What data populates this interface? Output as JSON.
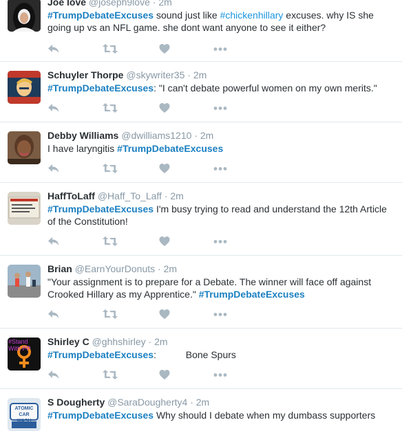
{
  "tweets": [
    {
      "name": "Joe love",
      "handle": "@joseph9love",
      "time": "2m",
      "segments": [
        {
          "t": "#TrumpDebateExcuses",
          "tag": "bold"
        },
        {
          "t": " sound just like "
        },
        {
          "t": "#chickenhillary",
          "tag": "plain"
        },
        {
          "t": " excuses. why IS she going up vs an NFL game. she dont want anyone to see it either?"
        }
      ],
      "avatar_icon": "nun-avatar"
    },
    {
      "name": "Schuyler Thorpe",
      "handle": "@skywriter35",
      "time": "2m",
      "segments": [
        {
          "t": "#TrumpDebateExcuses",
          "tag": "bold"
        },
        {
          "t": ": \"I can't debate powerful women on my own merits.\""
        }
      ],
      "avatar_icon": "poster-avatar"
    },
    {
      "name": "Debby Williams",
      "handle": "@dwilliams1210",
      "time": "2m",
      "segments": [
        {
          "t": "I have laryngitis "
        },
        {
          "t": "#TrumpDebateExcuses",
          "tag": "bold"
        }
      ],
      "avatar_icon": "portrait-avatar"
    },
    {
      "name": "HaffToLaff",
      "handle": "@Haff_To_Laff",
      "time": "2m",
      "segments": [
        {
          "t": "#TrumpDebateExcuses",
          "tag": "bold"
        },
        {
          "t": " I'm busy trying to read and understand the 12th Article of the Constitution!"
        }
      ],
      "avatar_icon": "ticket-avatar"
    },
    {
      "name": "Brian",
      "handle": "@EarnYourDonuts",
      "time": "2m",
      "segments": [
        {
          "t": "\"Your assignment is to prepare for a Debate.  The winner will face off against Crooked Hillary as my Apprentice.\" "
        },
        {
          "t": "#TrumpDebateExcuses",
          "tag": "bold"
        }
      ],
      "avatar_icon": "runners-avatar"
    },
    {
      "name": "Shirley C",
      "handle": "@ghhshirley",
      "time": "2m",
      "segments": [
        {
          "t": "#TrumpDebateExcuses",
          "tag": "bold"
        },
        {
          "t": ":           Bone Spurs"
        }
      ],
      "avatar_icon": "female-symbol-avatar",
      "avatar_text": "#Stand With PP"
    },
    {
      "name": "S Dougherty",
      "handle": "@SaraDougherty4",
      "time": "2m",
      "segments": [
        {
          "t": "#TrumpDebateExcuses",
          "tag": "bold"
        },
        {
          "t": "  Why should I debate when my dumbass supporters"
        }
      ],
      "avatar_icon": "car-wash-avatar",
      "avatar_text": "ATOMIC CAR WASH"
    }
  ],
  "separator": "·",
  "actions": [
    "reply-icon",
    "retweet-icon",
    "like-icon",
    "more-icon"
  ],
  "colors": {
    "link": "#1b95e0",
    "icon": "#aab8c2",
    "muted": "#8899a6",
    "divider": "#e1e8ed"
  }
}
